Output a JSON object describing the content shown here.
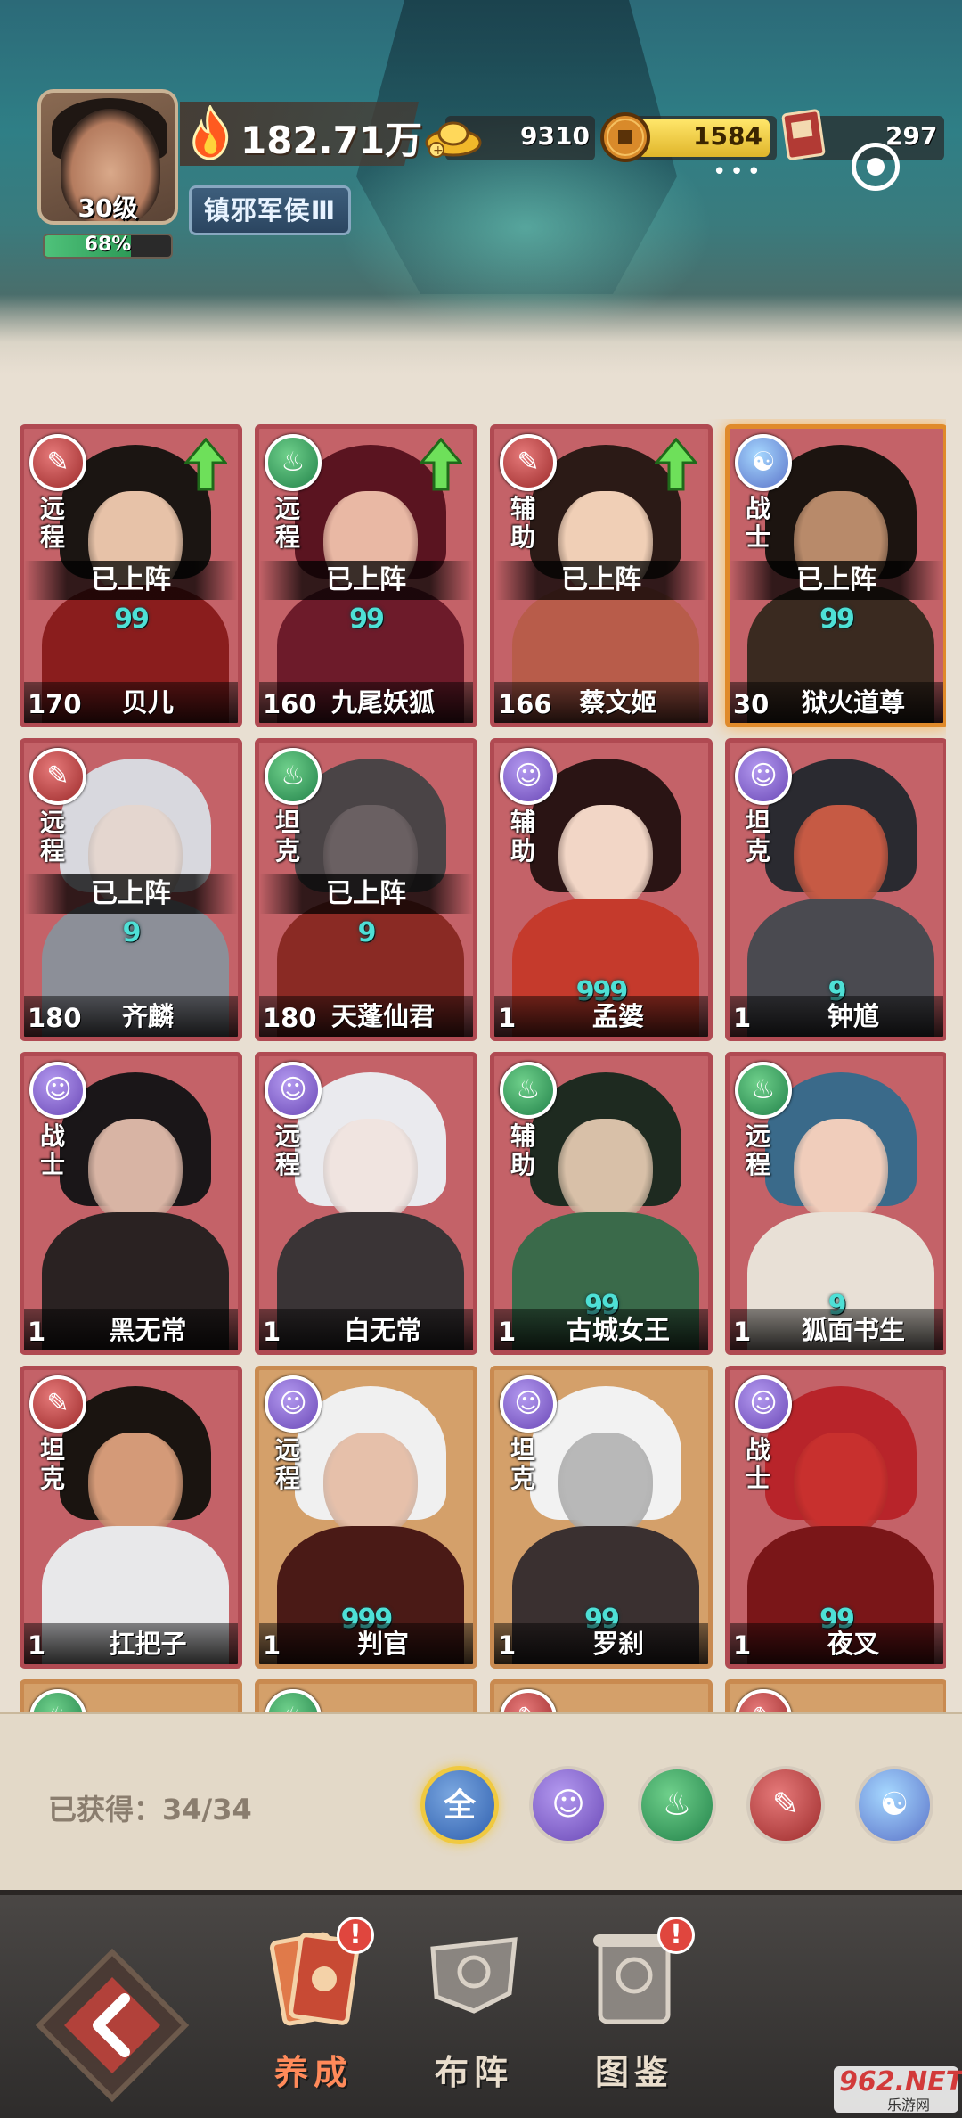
{
  "player": {
    "level_label": "30级",
    "exp_percent_label": "68%",
    "exp_fraction": 0.68,
    "power": "182.71万",
    "title": "镇邪军侯Ⅲ"
  },
  "resources": {
    "gold": "9310",
    "coins": "1584",
    "scrolls": "297",
    "more_dots": "•••"
  },
  "faction_glyphs": {
    "red": "✎",
    "green": "♨",
    "purple": "☺",
    "blue": "☯"
  },
  "deployed_label": "已上阵",
  "cards": [
    {
      "name": "贝儿",
      "level": "170",
      "role": "远程",
      "faction": "red",
      "deployed": true,
      "upgrade": true,
      "stars": "99",
      "tone": "red"
    },
    {
      "name": "九尾妖狐",
      "level": "160",
      "role": "远程",
      "faction": "green",
      "deployed": true,
      "upgrade": true,
      "stars": "99",
      "tone": "red"
    },
    {
      "name": "蔡文姬",
      "level": "166",
      "role": "辅助",
      "faction": "red",
      "deployed": true,
      "upgrade": true,
      "stars": "",
      "tone": "red"
    },
    {
      "name": "狱火道尊",
      "level": "30",
      "role": "战士",
      "faction": "blue",
      "deployed": true,
      "upgrade": false,
      "stars": "99",
      "tone": "gold"
    },
    {
      "name": "齐麟",
      "level": "180",
      "role": "远程",
      "faction": "red",
      "deployed": true,
      "upgrade": false,
      "stars": "9",
      "tone": "red"
    },
    {
      "name": "天蓬仙君",
      "level": "180",
      "role": "坦克",
      "faction": "green",
      "deployed": true,
      "upgrade": false,
      "stars": "9",
      "tone": "red"
    },
    {
      "name": "孟婆",
      "level": "1",
      "role": "辅助",
      "faction": "purple",
      "deployed": false,
      "upgrade": false,
      "stars": "999",
      "tone": "red"
    },
    {
      "name": "钟馗",
      "level": "1",
      "role": "坦克",
      "faction": "purple",
      "deployed": false,
      "upgrade": false,
      "stars": "9",
      "tone": "red"
    },
    {
      "name": "黑无常",
      "level": "1",
      "role": "战士",
      "faction": "purple",
      "deployed": false,
      "upgrade": false,
      "stars": "",
      "tone": "red"
    },
    {
      "name": "白无常",
      "level": "1",
      "role": "远程",
      "faction": "purple",
      "deployed": false,
      "upgrade": false,
      "stars": "",
      "tone": "red"
    },
    {
      "name": "古城女王",
      "level": "1",
      "role": "辅助",
      "faction": "green",
      "deployed": false,
      "upgrade": false,
      "stars": "99",
      "tone": "red"
    },
    {
      "name": "狐面书生",
      "level": "1",
      "role": "远程",
      "faction": "green",
      "deployed": false,
      "upgrade": false,
      "stars": "9",
      "tone": "red"
    },
    {
      "name": "扛把子",
      "level": "1",
      "role": "坦克",
      "faction": "red",
      "deployed": false,
      "upgrade": false,
      "stars": "",
      "tone": "red"
    },
    {
      "name": "判官",
      "level": "1",
      "role": "远程",
      "faction": "purple",
      "deployed": false,
      "upgrade": false,
      "stars": "999",
      "tone": "tan"
    },
    {
      "name": "罗刹",
      "level": "1",
      "role": "坦克",
      "faction": "purple",
      "deployed": false,
      "upgrade": false,
      "stars": "99",
      "tone": "tan"
    },
    {
      "name": "夜叉",
      "level": "1",
      "role": "战士",
      "faction": "purple",
      "deployed": false,
      "upgrade": false,
      "stars": "99",
      "tone": "red"
    }
  ],
  "partial_row_factions": [
    "green",
    "green",
    "red",
    "red"
  ],
  "collection": {
    "owned_label": "已获得：34/34",
    "filters": [
      {
        "id": "all",
        "label": "全"
      },
      {
        "id": "purple",
        "label": ""
      },
      {
        "id": "green",
        "label": ""
      },
      {
        "id": "red",
        "label": ""
      },
      {
        "id": "blue",
        "label": ""
      }
    ]
  },
  "nav": {
    "tabs": [
      {
        "id": "develop",
        "label": "养成",
        "active": true,
        "alert": "!"
      },
      {
        "id": "formation",
        "label": "布阵",
        "active": false,
        "alert": ""
      },
      {
        "id": "codex",
        "label": "图鉴",
        "active": false,
        "alert": "!"
      }
    ]
  },
  "watermark": {
    "main": "962.NET",
    "sub": "乐游网"
  }
}
